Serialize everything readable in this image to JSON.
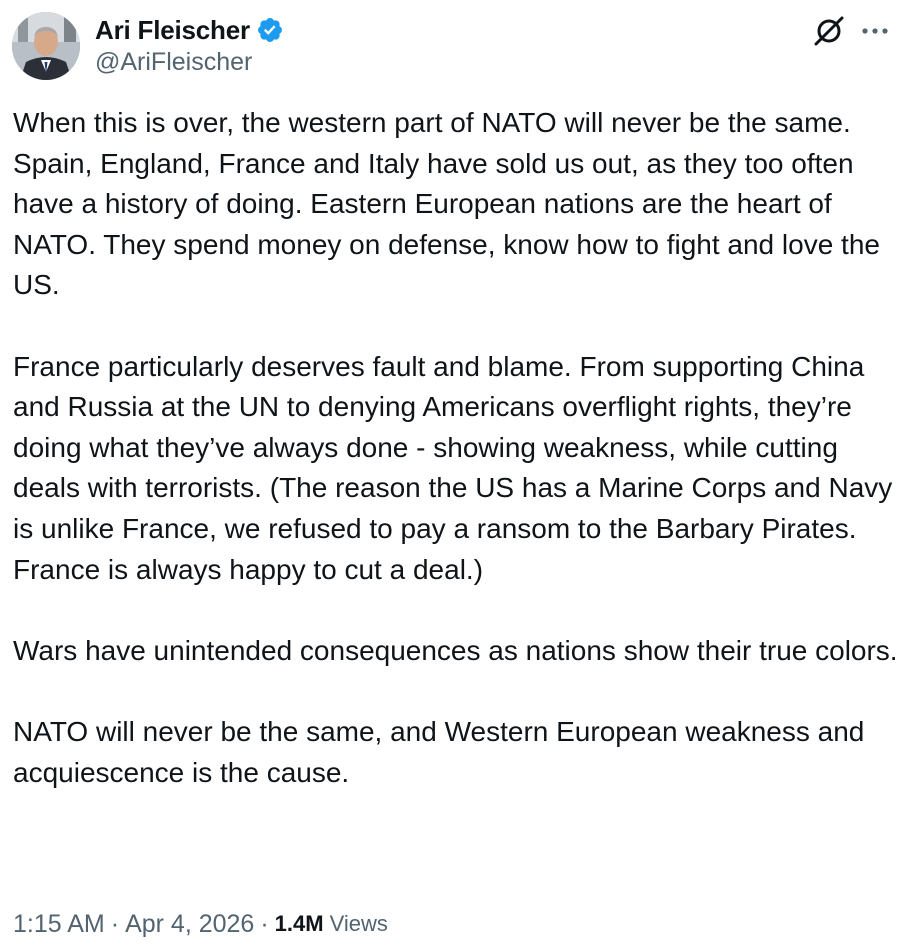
{
  "author": {
    "display_name": "Ari Fleischer",
    "handle": "@AriFleischer",
    "verified": true,
    "avatar_icon": "profile-photo"
  },
  "icons": {
    "grok": "grok-icon",
    "more": "more-options-icon",
    "verified": "verified-badge-icon"
  },
  "colors": {
    "verified_blue": "#1d9bf0",
    "text_primary": "#0f1419",
    "text_secondary": "#536471"
  },
  "tweet": {
    "paragraphs": [
      "When this is over, the western part of NATO will never be the same. Spain, England, France and Italy have sold us out, as they too often have a history of doing. Eastern European nations are the heart of NATO. They spend money on defense, know how to fight and love the US.",
      "France particularly deserves fault and blame. From supporting China and Russia at the UN to denying Americans overflight rights, they’re doing what they’ve always done - showing weakness, while cutting deals with terrorists. (The reason the US has a Marine Corps and Navy is unlike France, we refused to pay a ransom to the Barbary Pirates.  France is always happy to cut a deal.)",
      "Wars have unintended consequences as nations show their true colors.",
      "NATO will never be the same, and Western European weakness and acquiescence is the cause."
    ]
  },
  "meta": {
    "time": "1:15 AM",
    "separator": "·",
    "date": "Apr 4, 2026",
    "views_count": "1.4M",
    "views_label": "Views"
  }
}
